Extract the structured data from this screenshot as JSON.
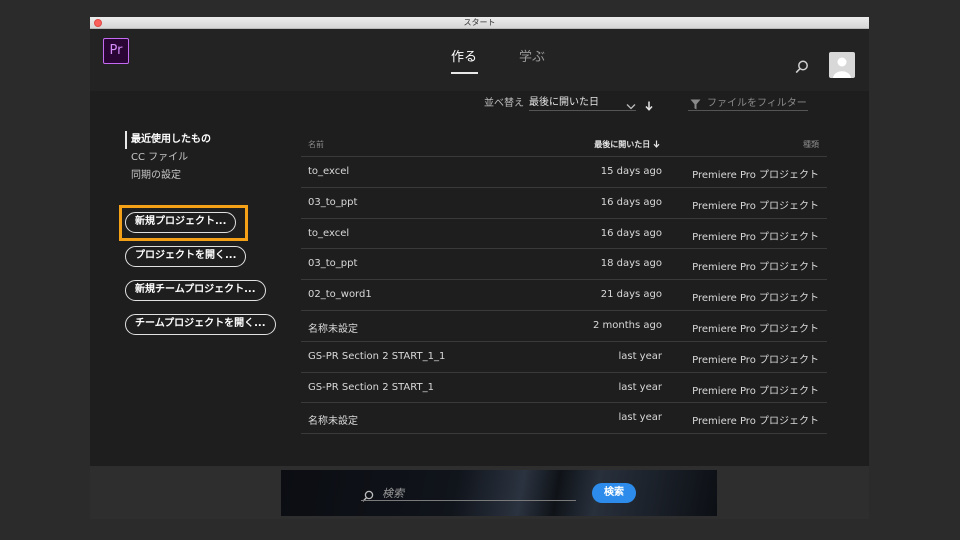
{
  "window": {
    "title": "スタート"
  },
  "app": {
    "logo": "Pr"
  },
  "tabs": [
    {
      "label": "作る",
      "active": true
    },
    {
      "label": "学ぶ",
      "active": false
    }
  ],
  "toolbar": {
    "sort_label": "並べ替え",
    "sort_value": "最後に開いた日",
    "filter_placeholder": "ファイルをフィルター"
  },
  "nav": {
    "items": [
      "最近使用したもの",
      "CC ファイル",
      "同期の設定"
    ],
    "active_index": 0
  },
  "actions": [
    "新規プロジェクト...",
    "プロジェクトを開く...",
    "新規チームプロジェクト...",
    "チームプロジェクトを開く..."
  ],
  "table": {
    "headers": {
      "name": "名前",
      "date": "最後に開いた日",
      "kind": "種類"
    },
    "rows": [
      {
        "name": "to_excel",
        "date": "15 days ago",
        "kind": "Premiere Pro プロジェクト"
      },
      {
        "name": "03_to_ppt",
        "date": "16 days ago",
        "kind": "Premiere Pro プロジェクト"
      },
      {
        "name": "to_excel",
        "date": "16 days ago",
        "kind": "Premiere Pro プロジェクト"
      },
      {
        "name": "03_to_ppt",
        "date": "18 days ago",
        "kind": "Premiere Pro プロジェクト"
      },
      {
        "name": "02_to_word1",
        "date": "21 days ago",
        "kind": "Premiere Pro プロジェクト"
      },
      {
        "name": "名称未設定",
        "date": "2 months ago",
        "kind": "Premiere Pro プロジェクト"
      },
      {
        "name": "GS-PR Section 2 START_1_1",
        "date": "last year",
        "kind": "Premiere Pro プロジェクト"
      },
      {
        "name": "GS-PR Section 2 START_1",
        "date": "last year",
        "kind": "Premiere Pro プロジェクト"
      },
      {
        "name": "名称未設定",
        "date": "last year",
        "kind": "Premiere Pro プロジェクト"
      }
    ]
  },
  "stock_search": {
    "placeholder": "検索",
    "button": "検索"
  },
  "colors": {
    "accent_highlight": "#f5a117",
    "search_button": "#2d8ceb",
    "logo_border": "#c56bf3"
  },
  "icons": [
    "search-icon",
    "avatar-icon",
    "chevron-down-icon",
    "sort-desc-arrow-icon",
    "filter-icon"
  ]
}
